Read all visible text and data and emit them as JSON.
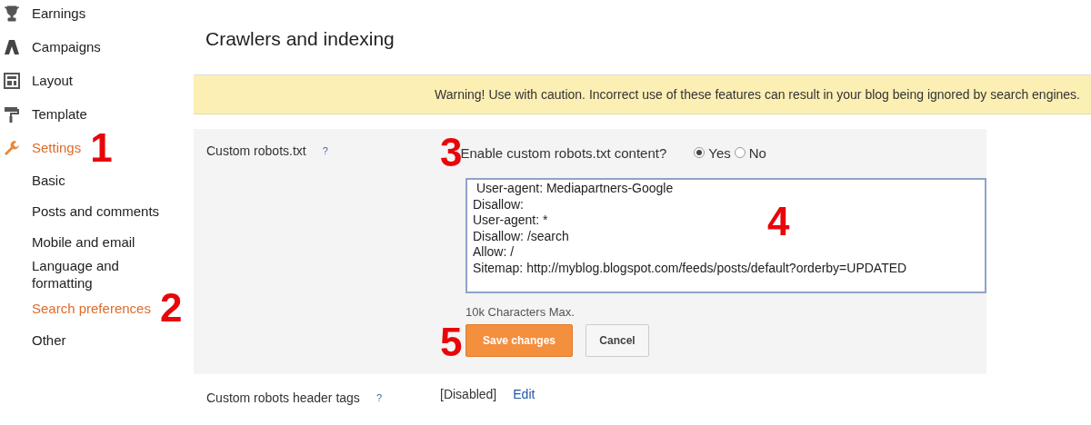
{
  "sidebar": {
    "items": [
      {
        "label": "Earnings",
        "selected": false
      },
      {
        "label": "Campaigns",
        "selected": false
      },
      {
        "label": "Layout",
        "selected": false
      },
      {
        "label": "Template",
        "selected": false
      },
      {
        "label": "Settings",
        "selected": true,
        "marker": "1",
        "children": [
          {
            "label": "Basic",
            "selected": false
          },
          {
            "label": "Posts and comments",
            "selected": false
          },
          {
            "label": "Mobile and email",
            "selected": false
          },
          {
            "label": "Language and formatting",
            "selected": false
          },
          {
            "label": "Search preferences",
            "selected": true,
            "marker": "2"
          },
          {
            "label": "Other",
            "selected": false
          }
        ]
      }
    ]
  },
  "main": {
    "title": "Crawlers and indexing",
    "warning": "Warning! Use with caution. Incorrect use of these features can result in your blog being ignored by search engines.",
    "robots": {
      "label": "Custom robots.txt",
      "help": "?",
      "marker": "3",
      "question": "Enable custom robots.txt content?",
      "options": [
        {
          "label": "Yes",
          "selected": true
        },
        {
          "label": "No",
          "selected": false
        }
      ],
      "content": " User-agent: Mediapartners-Google\nDisallow:\nUser-agent: *\nDisallow: /search\nAllow: /\nSitemap: http://myblog.blogspot.com/feeds/posts/default?orderby=UPDATED",
      "content_marker": "4",
      "limit": "10k Characters Max.",
      "buttons_marker": "5",
      "buttons": [
        {
          "label": "Save changes",
          "kind": "primary"
        },
        {
          "label": "Cancel",
          "kind": "secondary"
        }
      ]
    },
    "header_tags": {
      "label": "Custom robots header tags",
      "help": "?",
      "status": "[Disabled]",
      "action": "Edit"
    }
  }
}
